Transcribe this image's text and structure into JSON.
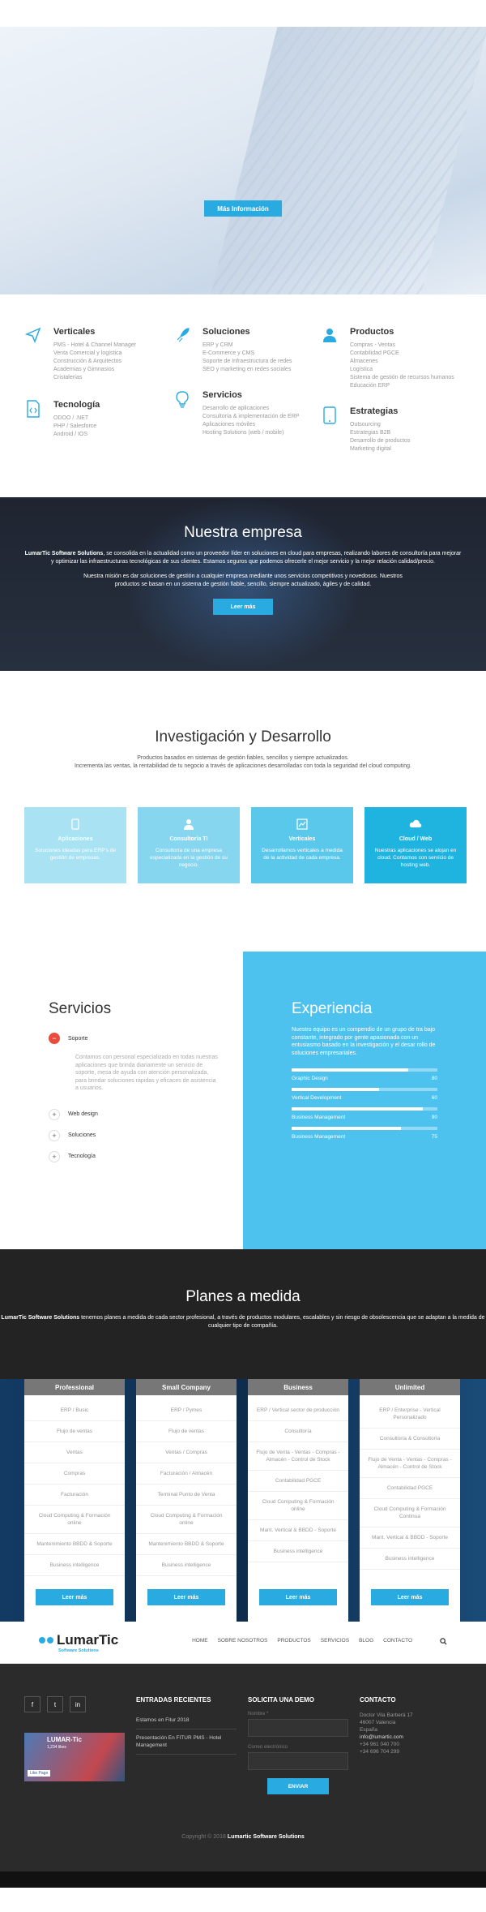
{
  "hero": {
    "button": "Más Información"
  },
  "categories": [
    {
      "title": "Verticales",
      "icon": "paper-plane-icon",
      "items": [
        "PMS - Hotel & Channel Manager",
        "Venta Comercial y logística",
        "Construcción & Arquitectos",
        "Academias y Gimnasios",
        "Cristalerías"
      ]
    },
    {
      "title": "Soluciones",
      "icon": "rocket-icon",
      "items": [
        "ERP y CRM",
        "E-Commerce y CMS",
        "Soporte de Infraestructura de redes",
        "SEO y marketing en redes sociales"
      ]
    },
    {
      "title": "Productos",
      "icon": "user-icon",
      "items": [
        "Compras - Ventas",
        "Contabilidad PGCE",
        "Almacenes",
        "Logística",
        "Sistema de gestión de recursos humanos",
        "Educación ERP"
      ]
    },
    {
      "title": "Tecnología",
      "icon": "code-icon",
      "items": [
        "ODOO / .NET",
        "PHP / Salesforce",
        "Android / IOS"
      ]
    },
    {
      "title": "Servicios",
      "icon": "lightbulb-icon",
      "items": [
        "Desarrollo de aplicaciones",
        "Consultoría & implementación de ERP",
        "Aplicaciones móviles",
        "Hosting Solutions (web / mobile)"
      ]
    },
    {
      "title": "Estrategias",
      "icon": "tablet-icon",
      "items": [
        "Outsourcing",
        "Estrategias B2B",
        "Desarrollo de productos",
        "Marketing digital"
      ]
    }
  ],
  "empresa": {
    "title": "Nuestra empresa",
    "company": "LumarTic Software Solutions",
    "p1": ", se consolida en la actualidad como un proveedor líder en soluciones en cloud para empresas, realizando labores de consultoría para mejorar y optimizar las infraestructuras tecnológicas de sus clientes. Estamos seguros que podemos ofrecerle el mejor servicio y la mejor relación calidad/precio.",
    "p2": "Nuestra misión es dar soluciones de gestión a cualquier empresa mediante unos servicios competitivos y novedosos. Nuestros productos se basan en un sistema de gestión fiable, sencillo, siempre actualizado, ágiles y de calidad.",
    "button": "Leer más"
  },
  "investigacion": {
    "title": "Investigación y Desarrollo",
    "line1": "Productos basados en sistemas de gestión fiables, sencillos y siempre actualizados.",
    "line2": "Incrementa las ventas, la rentabilidad de tu negocio a través de aplicaciones desarrolladas con toda la seguridad del cloud computing.",
    "boxes": [
      {
        "title": "Aplicaciones",
        "icon": "mobile-icon",
        "text": "Soluciones ideadas para ERP's de gestión de empresas.",
        "color": "#a8e2f3"
      },
      {
        "title": "Consultoría TI",
        "icon": "user-icon",
        "text": "Consultoría de una empresa especializada en la gestión de su negocio.",
        "color": "#86d6ef"
      },
      {
        "title": "Verticales",
        "icon": "chart-icon",
        "text": "Desarrollamos verticales a medida de la actividad de cada empresa.",
        "color": "#5ac8eb"
      },
      {
        "title": "Cloud / Web",
        "icon": "cloud-icon",
        "text": "Nuestras aplicaciones se alojan en cloud. Contamos con servicio de hosting web.",
        "color": "#1fb3e0"
      }
    ]
  },
  "servicios": {
    "title": "Servicios",
    "items": [
      {
        "label": "Soporte",
        "open": true,
        "text": "Contamos con personal especializado en todas nuestras aplicaciones que brinda diariamente un servicio de soporte, mesa de ayuda con atención personalizada, para brindar soluciones rápidas y eficaces de asistencia a usuarios."
      },
      {
        "label": "Web design",
        "open": false
      },
      {
        "label": "Soluciones",
        "open": false
      },
      {
        "label": "Tecnología",
        "open": false
      }
    ]
  },
  "experiencia": {
    "title": "Experiencia",
    "text": "Nuestro equipo es un compendio de un grupo de tra bajo constante, integrado por gente apasionada con un entusiasmo basado en la investigación y el desar rollo de soluciones empresariales.",
    "bars": [
      {
        "label": "Graphic Design",
        "value": 80
      },
      {
        "label": "Vertical Development",
        "value": 60
      },
      {
        "label": "Business Management",
        "value": 90
      },
      {
        "label": "Business Management",
        "value": 75
      }
    ]
  },
  "planes": {
    "title": "Planes a medida",
    "company": "LumarTic Software Solutions",
    "text": " tenemos planes a medida de cada sector profesional, a través de productos modulares, escalables y sin riesgo de obsolescencia que se adaptan a la medida de cualquier tipo de compañía.",
    "plans": [
      {
        "name": "Professional",
        "items": [
          "ERP / Busic",
          "Flujo de ventas",
          "Ventas",
          "Compras",
          "Facturación",
          "Cloud Computing & Formación online",
          "Mantenimiento BBDD & Soporte",
          "Business intelligence"
        ],
        "button": "Leer más"
      },
      {
        "name": "Small Company",
        "items": [
          "ERP / Pymes",
          "Flujo de ventas",
          "Ventas / Compras",
          "Facturación / Almacén",
          "Terminal Punto de Venta",
          "Cloud Computing & Formación online",
          "Mantenimiento BBDD & Soporte",
          "Business intelligence"
        ],
        "button": "Leer más"
      },
      {
        "name": "Business",
        "items": [
          "ERP / Vertical sector de producción",
          "Consultoría",
          "Flujo de Venta - Ventas - Compras - Almacén - Control de Stock",
          "Contabilidad PGCE",
          "Cloud Computing & Formación online",
          "Mant. Vertical & BBDD - Soporte",
          "Business intelligence"
        ],
        "button": "Leer más"
      },
      {
        "name": "Unlimited",
        "items": [
          "ERP / Enterprise - Vertical Personalizado",
          "Consultoría & Consultoría",
          "Flujo de Venta - Ventas - Compras - Almacén - Control de Stock",
          "Contabilidad PGCE",
          "Cloud Computing & Formación Continua",
          "Mant. Vertical & BBDD - Soporte",
          "Business intelligence"
        ],
        "button": "Leer más"
      }
    ]
  },
  "nav": {
    "logo": "LumarTic",
    "logo_sub": "Software Solutions",
    "items": [
      "HOME",
      "SOBRE NOSOTROS",
      "PRODUCTOS",
      "SERVICIOS",
      "BLOG",
      "CONTACTO"
    ]
  },
  "footer": {
    "social": [
      "f",
      "t",
      "in"
    ],
    "fb_title": "LUMAR-Tic",
    "fb_sub": "1,234 likes",
    "fb_like": "Like Page",
    "posts_title": "ENTRADAS RECIENTES",
    "posts": [
      "Estamos en Fitur 2018",
      "Presentación En FITUR PMS - Hotel Management"
    ],
    "demo_title": "SOLICITA UNA DEMO",
    "demo_name": "Nombre *",
    "demo_email": "Correo electrónico",
    "demo_button": "ENVIAR",
    "contact_title": "CONTACTO",
    "contact": [
      "Doctor Vila Barberá 17",
      "46007 Valencia",
      "España",
      "info@lumartic.com",
      "+34 961 040 700",
      "+34 696 704 299"
    ],
    "copyright": "Copyright © 2018",
    "copyright_company": "Lumartic Software Solutions"
  }
}
